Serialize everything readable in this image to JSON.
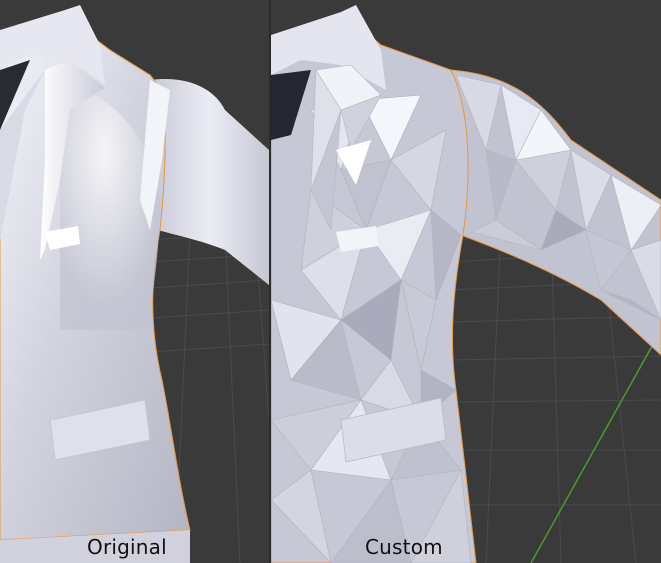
{
  "panels": [
    {
      "caption": "Original"
    },
    {
      "caption": "Custom"
    }
  ],
  "colors": {
    "viewport_background": "#3a3a3a",
    "grid_line": "#4a4a4a",
    "y_axis": "#4c9a2a",
    "mesh_light": "#ecedf5",
    "mesh_shadow": "#a7a8b6",
    "selection_outline": "#e8963c"
  }
}
